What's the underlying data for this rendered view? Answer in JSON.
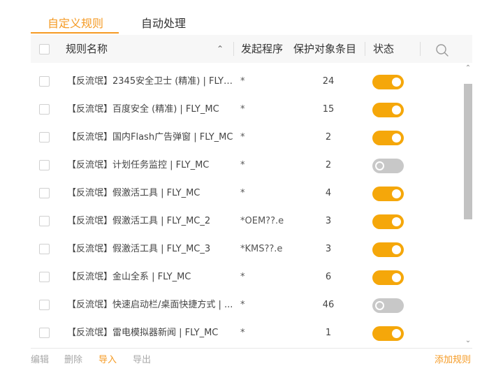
{
  "tabs": [
    {
      "label": "自定义规则",
      "active": true
    },
    {
      "label": "自动处理",
      "active": false
    }
  ],
  "table": {
    "headers": {
      "name": "规则名称",
      "process": "发起程序",
      "count": "保护对象条目",
      "status": "状态"
    },
    "rows": [
      {
        "name": "【反流氓】2345安全卫士 (精准) | FLY_...",
        "process": "*",
        "count": "24",
        "enabled": true
      },
      {
        "name": "【反流氓】百度安全 (精准) | FLY_MC",
        "process": "*",
        "count": "15",
        "enabled": true
      },
      {
        "name": "【反流氓】国内Flash广告弹窗 | FLY_MC",
        "process": "*",
        "count": "2",
        "enabled": true
      },
      {
        "name": "【反流氓】计划任务监控 | FLY_MC",
        "process": "*",
        "count": "2",
        "enabled": false
      },
      {
        "name": "【反流氓】假激活工具 | FLY_MC",
        "process": "*",
        "count": "4",
        "enabled": true
      },
      {
        "name": "【反流氓】假激活工具 | FLY_MC_2",
        "process": "*OEM??.e",
        "count": "3",
        "enabled": true
      },
      {
        "name": "【反流氓】假激活工具 | FLY_MC_3",
        "process": "*KMS??.e",
        "count": "3",
        "enabled": true
      },
      {
        "name": "【反流氓】金山全系 | FLY_MC",
        "process": "*",
        "count": "6",
        "enabled": true
      },
      {
        "name": "【反流氓】快速启动栏/桌面快捷方式 | ...",
        "process": "*",
        "count": "46",
        "enabled": false
      },
      {
        "name": "【反流氓】雷电模拟器新闻 | FLY_MC",
        "process": "*",
        "count": "1",
        "enabled": true
      }
    ]
  },
  "footer": {
    "edit": "编辑",
    "delete": "删除",
    "import": "导入",
    "export": "导出",
    "add": "添加规则"
  },
  "icons": {
    "sort": "chevron-up-icon",
    "search": "search-icon",
    "scroll_up": "chevron-up-icon",
    "scroll_down": "chevron-down-icon"
  },
  "colors": {
    "accent": "#f59a23",
    "toggle_on": "#f5a70a",
    "toggle_off": "#c8c8c8"
  }
}
